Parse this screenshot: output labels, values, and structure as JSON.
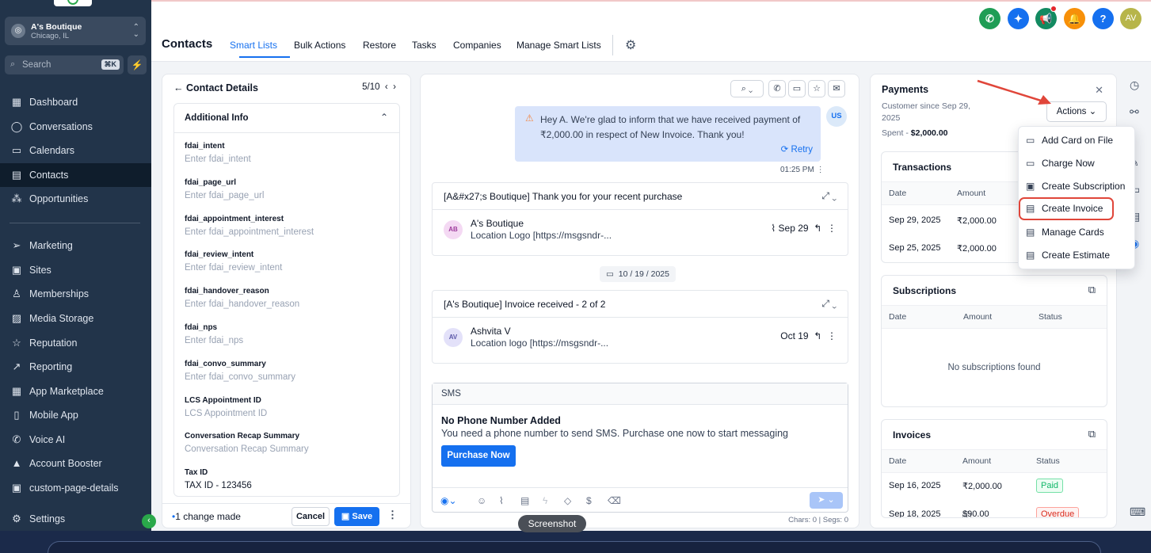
{
  "sidebar": {
    "location_name": "A's Boutique",
    "location_city": "Chicago, IL",
    "search_placeholder": "Search",
    "search_shortcut": "⌘K",
    "items": [
      {
        "label": "Dashboard",
        "icon": "grid-icon",
        "glyph": "▦"
      },
      {
        "label": "Conversations",
        "icon": "chat-icon",
        "glyph": "◯"
      },
      {
        "label": "Calendars",
        "icon": "calendar-icon",
        "glyph": "▭"
      },
      {
        "label": "Contacts",
        "icon": "contacts-icon",
        "glyph": "▤"
      },
      {
        "label": "Opportunities",
        "icon": "opportunities-icon",
        "glyph": "⁂"
      },
      {
        "label": "Marketing",
        "icon": "send-icon",
        "glyph": "➢"
      },
      {
        "label": "Sites",
        "icon": "sites-icon",
        "glyph": "▣"
      },
      {
        "label": "Memberships",
        "icon": "membership-icon",
        "glyph": "♙"
      },
      {
        "label": "Media Storage",
        "icon": "media-icon",
        "glyph": "▨"
      },
      {
        "label": "Reputation",
        "icon": "star-icon",
        "glyph": "☆"
      },
      {
        "label": "Reporting",
        "icon": "chart-icon",
        "glyph": "↗"
      },
      {
        "label": "App Marketplace",
        "icon": "apps-icon",
        "glyph": "▦"
      },
      {
        "label": "Mobile App",
        "icon": "mobile-icon",
        "glyph": "▯"
      },
      {
        "label": "Voice AI",
        "icon": "phone-icon",
        "glyph": "✆"
      },
      {
        "label": "Account Booster",
        "icon": "booster-icon",
        "glyph": "▲"
      },
      {
        "label": "custom-page-details",
        "icon": "page-icon",
        "glyph": "▣"
      },
      {
        "label": "Settings",
        "icon": "settings-icon",
        "glyph": "⚙"
      }
    ],
    "active": "Contacts"
  },
  "header": {
    "title": "Contacts",
    "tabs": [
      "Smart Lists",
      "Bulk Actions",
      "Restore",
      "Tasks",
      "Companies",
      "Manage Smart Lists"
    ],
    "active_tab": "Smart Lists",
    "user_initials": "AV",
    "help": "?"
  },
  "contact_details": {
    "title": "Contact Details",
    "pager": "5/10",
    "section": "Additional Info",
    "fields": [
      {
        "label": "fdai_intent",
        "value": "Enter fdai_intent",
        "filled": false
      },
      {
        "label": "fdai_page_url",
        "value": "Enter fdai_page_url",
        "filled": false
      },
      {
        "label": "fdai_appointment_interest",
        "value": "Enter fdai_appointment_interest",
        "filled": false
      },
      {
        "label": "fdai_review_intent",
        "value": "Enter fdai_review_intent",
        "filled": false
      },
      {
        "label": "fdai_handover_reason",
        "value": "Enter fdai_handover_reason",
        "filled": false
      },
      {
        "label": "fdai_nps",
        "value": "Enter fdai_nps",
        "filled": false
      },
      {
        "label": "fdai_convo_summary",
        "value": "Enter fdai_convo_summary",
        "filled": false
      },
      {
        "label": "LCS Appointment ID",
        "value": "LCS Appointment ID",
        "filled": false
      },
      {
        "label": "Conversation Recap Summary",
        "value": "Conversation Recap Summary",
        "filled": false
      },
      {
        "label": "Tax ID",
        "value": "TAX ID - 123456",
        "filled": true
      }
    ],
    "change_text": "1 change made",
    "cancel": "Cancel",
    "save": "Save"
  },
  "conversation": {
    "message": "Hey A. We're glad to inform that we have received payment of ₹2,000.00 in respect of New Invoice. Thank you!",
    "retry": "Retry",
    "sender_initials": "US",
    "time": "01:25 PM",
    "emails": [
      {
        "subject": "[A&#x27;s Boutique] Thank you for your recent purchase",
        "initials": "AB",
        "name": "A's Boutique",
        "preview": "Location Logo [https://msgsndr-...",
        "date": "Sep 29"
      },
      {
        "subject": "[A's Boutique] Invoice received - 2 of 2",
        "initials": "AV",
        "name": "Ashvita V",
        "preview": "Location logo [https://msgsndr-...",
        "date": "Oct 19"
      }
    ],
    "date_chip": "10 / 19 / 2025",
    "sms_label": "SMS",
    "no_phone_title": "No Phone Number Added",
    "no_phone_text": "You need a phone number to send SMS. Purchase one now to start messaging",
    "purchase": "Purchase Now",
    "chars": "Chars: 0 | Segs: 0"
  },
  "payments": {
    "title": "Payments",
    "customer_since": "Customer since Sep 29, 2025",
    "spent_label": "Spent - ",
    "spent_value": "$2,000.00",
    "actions": "Actions",
    "transactions": {
      "title": "Transactions",
      "headers": [
        "Date",
        "Amount"
      ],
      "rows": [
        {
          "date": "Sep 29, 2025",
          "amount": "₹2,000.00"
        },
        {
          "date": "Sep 25, 2025",
          "amount": "₹2,000.00"
        }
      ]
    },
    "subscriptions": {
      "title": "Subscriptions",
      "headers": [
        "Date",
        "Amount",
        "Status"
      ],
      "empty": "No subscriptions found"
    },
    "invoices": {
      "title": "Invoices",
      "headers": [
        "Date",
        "Amount",
        "Status"
      ],
      "rows": [
        {
          "date": "Sep 16, 2025",
          "amount": "₹2,000.00",
          "status": "Paid"
        },
        {
          "date": "Sep 18, 2025",
          "amount": "$90.00",
          "status": "Overdue"
        }
      ]
    },
    "menu": [
      "Add Card on File",
      "Charge Now",
      "Create Subscription",
      "Create Invoice",
      "Manage Cards",
      "Create Estimate"
    ],
    "highlighted": "Create Invoice"
  },
  "tooltip": "Screenshot",
  "colors": {
    "accent": "#1570ef",
    "sidebar": "#22344a",
    "highlight": "#e0463a",
    "success": "#2aa84a"
  }
}
